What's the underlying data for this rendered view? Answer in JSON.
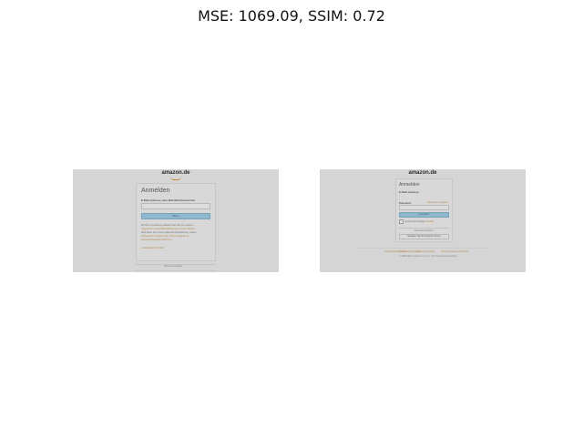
{
  "figure": {
    "title": "MSE: 1069.09, SSIM: 0.72"
  },
  "left_panel": {
    "logo": "amazon.de",
    "heading": "Anmelden",
    "email_label": "E-Mail-Adresse oder Mobiltelefonnummer",
    "email_value": "",
    "continue_button": "Weiter",
    "legal_line1": "Mit Ihrer Anmeldung erklären Sie sich mit unseren",
    "legal_line2": "Allgemeinen Geschäftsbedingungen einverstanden.",
    "legal_line3": "Bitte lesen Sie unsere Datenschutzerklärung, unsere",
    "legal_line4": "Hinweise zu Cookies und unsere Hinweise zu",
    "legal_line5": "interessenbasierter Werbung.",
    "help_link": "Benötigen Sie Hilfe?",
    "new_customer": "Neu bei Amazon?"
  },
  "right_panel": {
    "logo": "amazon.de",
    "heading": "Anmelden",
    "email_label": "E-Mail-Adresse",
    "password_label": "Passwort",
    "forgot_link": "Passwort vergessen",
    "password_value": "",
    "login_button": "Anmelden",
    "remember_label": "Angemeldet bleiben.",
    "remember_link": "Details",
    "new_to_amazon": "Neu bei Amazon?",
    "create_account_button": "Erstellen Sie Ihr Amazon-Konto",
    "footer_links": [
      "Nutzungsbedingungen",
      "Datenschutzerklärung",
      "Impressum",
      "Cookies",
      "Interessenbasierte Werbung"
    ],
    "copyright": "© 1998-2024, Amazon.com, Inc. oder Tochtergesellschaften"
  }
}
